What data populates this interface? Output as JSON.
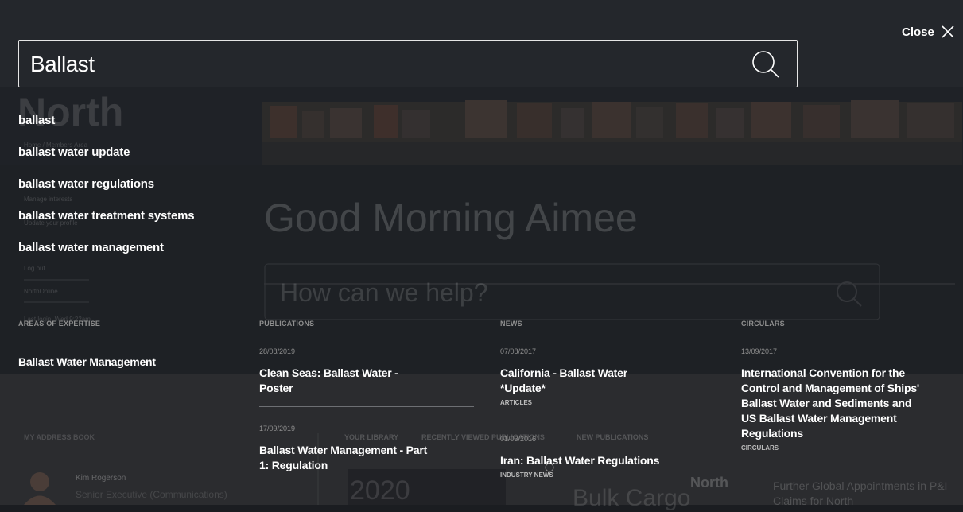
{
  "overlay": {
    "close_label": "Close",
    "search_value": "Ballast"
  },
  "suggestions": [
    "ballast",
    "ballast water update",
    "ballast water regulations",
    "ballast water treatment systems",
    "ballast water management"
  ],
  "columns": {
    "expertise": {
      "heading": "AREAS OF EXPERTISE",
      "items": [
        {
          "title": "Ballast Water Management"
        }
      ]
    },
    "publications": {
      "heading": "PUBLICATIONS",
      "items": [
        {
          "date": "28/08/2019",
          "title": "Clean Seas: Ballast Water - Poster"
        },
        {
          "date": "17/09/2019",
          "title": "Ballast Water Management - Part 1: Regulation"
        }
      ]
    },
    "news": {
      "heading": "NEWS",
      "items": [
        {
          "date": "07/08/2017",
          "title": "California - Ballast Water *Update*",
          "category": "ARTICLES"
        },
        {
          "date": "01/03/2016",
          "title": "Iran: Ballast Water Regulations",
          "category": "INDUSTRY NEWS"
        }
      ]
    },
    "circulars": {
      "heading": "CIRCULARS",
      "items": [
        {
          "date": "13/09/2017",
          "title": "International Convention for the Control and Management of Ships' Ballast Water and Sediments and US Ballast Water Management Regulations",
          "category": "CIRCULARS"
        }
      ]
    }
  },
  "background_page": {
    "logo": "North",
    "breadcrumb": "Home / Members Area",
    "sidebar_links": [
      "Manage interests",
      "Update your profile",
      "Log out",
      "NorthOnline"
    ],
    "last_login": "Last login: Wed 9:22am",
    "greeting": "Good Morning Aimee",
    "help_placeholder": "How can we help?",
    "address_book_heading": "MY ADDRESS BOOK",
    "contact_name": "Kim Rogerson",
    "contact_role": "Senior Executive (Communications)",
    "tabs": [
      "YOUR LIBRARY",
      "RECENTLY VIEWED PUBLICATIONS",
      "NEW PUBLICATIONS"
    ],
    "year_text": "2020",
    "bulk_text": "Bulk Cargo",
    "further_text": "Further Global Appointments in P&I Claims for North"
  },
  "colors": {
    "overlay": "#1b1d21",
    "text": "#ffffff",
    "meta": "#8f8f8f"
  }
}
